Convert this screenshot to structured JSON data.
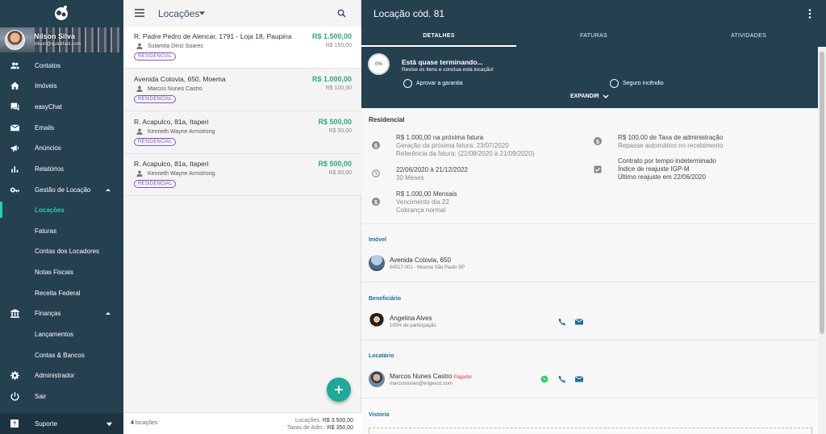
{
  "user": {
    "name": "Nilson Silva",
    "email": "nilson@quickfast.com"
  },
  "sidebar": {
    "items": [
      {
        "label": "Contatos",
        "icon": "people-icon"
      },
      {
        "label": "Imóveis",
        "icon": "home-icon"
      },
      {
        "label": "easyChat",
        "icon": "chat-icon"
      },
      {
        "label": "Emails",
        "icon": "mail-icon"
      },
      {
        "label": "Anúncios",
        "icon": "megaphone-icon"
      },
      {
        "label": "Relatórios",
        "icon": "bar-chart-icon"
      },
      {
        "label": "Gestão de Locação",
        "icon": "key-icon"
      },
      {
        "label": "Finanças",
        "icon": "bank-icon"
      },
      {
        "label": "Administrador",
        "icon": "gear-icon"
      },
      {
        "label": "Sair",
        "icon": "power-icon"
      }
    ],
    "gestao_sub": [
      "Locações",
      "Faturas",
      "Contas dos Locadores",
      "Notas Fiscais",
      "Receita Federal"
    ],
    "financas_sub": [
      "Lançamentos",
      "Contas & Bancos"
    ],
    "support": "Suporte"
  },
  "list": {
    "title": "Locações",
    "cards": [
      {
        "address": "R. Padre Pedro de Alencar, 1791 - Loja 18, Paupina",
        "price": "R$ 1.500,00",
        "secondary": "R$ 150,00",
        "tenant": "Sulamita Diniz Soares",
        "badge": "RESIDENCIAL"
      },
      {
        "address": "Avenida Cotovia, 650, Moema",
        "price": "R$ 1.000,00",
        "secondary": "R$ 100,00",
        "tenant": "Marcos Nunes Castro",
        "badge": "RESIDENCIAL"
      },
      {
        "address": "R. Acapulco, 81a, Itaperi",
        "price": "R$ 500,00",
        "secondary": "R$ 50,00",
        "tenant": "Kenneth Wayne Armstrong",
        "badge": "RESIDENCIAL"
      },
      {
        "address": "R. Acapulco, 81a, Itaperi",
        "price": "R$ 500,00",
        "secondary": "R$ 50,00",
        "tenant": "Kenneth Wayne Armstrong.",
        "badge": "RESIDENCIAL"
      }
    ],
    "footer": {
      "count": "4",
      "count_suffix": "locações",
      "locacoes_label": "Locações:",
      "locacoes_value": "R$ 3.500,00",
      "taxas_label": "Taxas de Adm.:",
      "taxas_value": "R$ 350,00"
    }
  },
  "detail": {
    "title": "Locação cód. 81",
    "tabs": [
      "DETALHES",
      "FATURAS",
      "ATIVIDADES"
    ],
    "progress": {
      "percent": "0%",
      "title": "Está quase terminando...",
      "subtitle": "Revise os itens e conclua esta locação!",
      "items": [
        "Aprovar a garantia",
        "Seguro incêndio"
      ],
      "expand": "EXPANDIR"
    },
    "residencial": {
      "title": "Residencial",
      "fatura": [
        "R$ 1.000,00 na próxima fatura",
        "Geração da próxima fatura: 23/07/2020",
        "Referência da fatura: (22/08/2020 à 21/09/2020)"
      ],
      "periodo": [
        "22/06/2020 à 21/12/2022",
        "30 Meses"
      ],
      "mensal": [
        "R$ 1.000,00 Mensais",
        "Vencimento dia 22",
        "Cobrança normal"
      ],
      "taxa": [
        "R$ 100,00 de Taxa de administração",
        "Repasse automático no recebimento"
      ],
      "contrato": [
        "Contrato por tempo indeterminado",
        "Índice de reajuste IGP-M",
        "Último reajuste em 22/06/2020"
      ]
    },
    "imovel": {
      "title": "Imóvel",
      "name": "Avenida Cotovia, 650",
      "sub": "04517-001 - Moema São Paulo SP"
    },
    "beneficiario": {
      "title": "Beneficiário",
      "name": "Angelina Alves",
      "sub": "100% de participação"
    },
    "locatario": {
      "title": "Locatário",
      "name": "Marcos Nunes Castro",
      "tag": "Pagador",
      "sub": "marcosnunes@engevoz.com"
    },
    "vistoria": {
      "title": "Vistoria"
    }
  },
  "colors": {
    "sidebar": "#25404f",
    "accent": "#1ed3b0",
    "price": "#2daa7d",
    "badge": "#7e57c2",
    "fab": "#1eaa96"
  }
}
